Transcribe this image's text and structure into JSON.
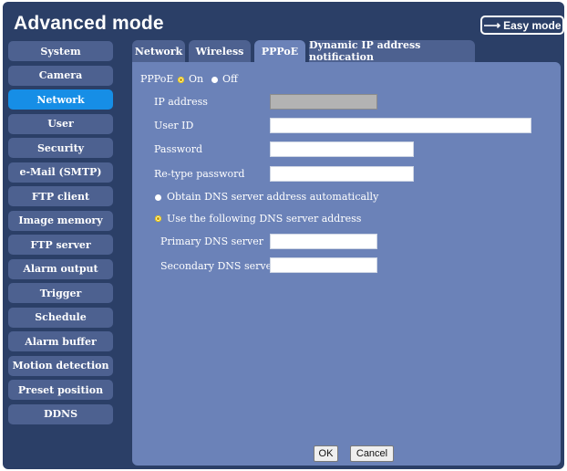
{
  "header": {
    "title": "Advanced mode",
    "easy_mode_label": "Easy mode",
    "easy_mode_icon": "right-arrow-icon"
  },
  "sidebar": {
    "active": "Network",
    "items": [
      {
        "label": "System"
      },
      {
        "label": "Camera"
      },
      {
        "label": "Network"
      },
      {
        "label": "User"
      },
      {
        "label": "Security"
      },
      {
        "label": "e-Mail (SMTP)"
      },
      {
        "label": "FTP client"
      },
      {
        "label": "Image memory"
      },
      {
        "label": "FTP server"
      },
      {
        "label": "Alarm output"
      },
      {
        "label": "Trigger"
      },
      {
        "label": "Schedule"
      },
      {
        "label": "Alarm buffer"
      },
      {
        "label": "Motion detection"
      },
      {
        "label": "Preset position"
      },
      {
        "label": "DDNS"
      }
    ]
  },
  "tabs": {
    "active": "PPPoE",
    "items": [
      {
        "label": "Network"
      },
      {
        "label": "Wireless"
      },
      {
        "label": "PPPoE"
      },
      {
        "label": "Dynamic IP address notification"
      }
    ]
  },
  "form": {
    "pppoe_label": "PPPoE",
    "pppoe_on_label": "On",
    "pppoe_off_label": "Off",
    "pppoe_selected": "On",
    "ip_address_label": "IP address",
    "ip_address_value": "",
    "user_id_label": "User ID",
    "user_id_value": "",
    "password_label": "Password",
    "password_value": "",
    "retype_password_label": "Re-type password",
    "retype_password_value": "",
    "dns_auto_label": "Obtain DNS server address automatically",
    "dns_manual_label": "Use the following DNS server address",
    "dns_selected": "Use the following DNS server address",
    "primary_dns_label": "Primary DNS server",
    "primary_dns_value": "",
    "secondary_dns_label": "Secondary DNS server",
    "secondary_dns_value": ""
  },
  "footer": {
    "ok_label": "OK",
    "cancel_label": "Cancel"
  },
  "colors": {
    "background": "#2b3f67",
    "nav_button": "#4d6190",
    "nav_active": "#168ee6",
    "panel": "#6b82b8",
    "radio_selected": "#fff3b3"
  }
}
